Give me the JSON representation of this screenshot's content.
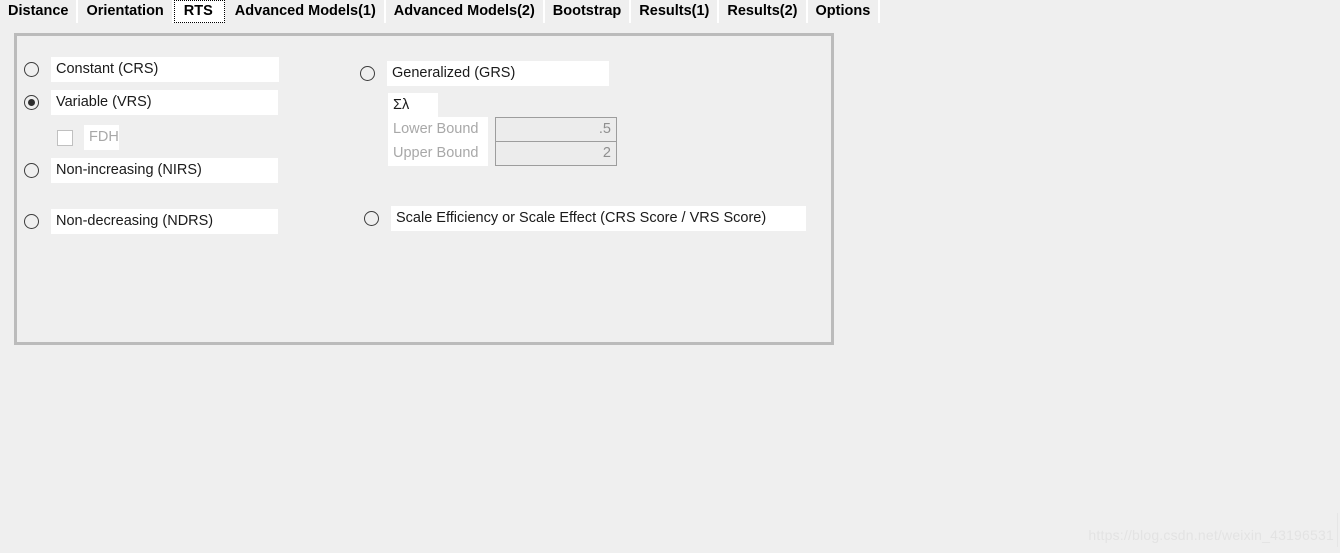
{
  "tabs": [
    {
      "label": "Distance",
      "active": false
    },
    {
      "label": "Orientation",
      "active": false
    },
    {
      "label": "RTS",
      "active": true
    },
    {
      "label": "Advanced Models(1)",
      "active": false
    },
    {
      "label": "Advanced Models(2)",
      "active": false
    },
    {
      "label": "Bootstrap",
      "active": false
    },
    {
      "label": "Results(1)",
      "active": false
    },
    {
      "label": "Results(2)",
      "active": false
    },
    {
      "label": "Options",
      "active": false
    }
  ],
  "panel": {
    "left_column": {
      "constant": {
        "label": "Constant (CRS)",
        "selected": false
      },
      "variable": {
        "label": "Variable (VRS)",
        "selected": true
      },
      "fdh": {
        "label": "FDH",
        "checked": false,
        "enabled": false
      },
      "non_increasing": {
        "label": "Non-increasing (NIRS)",
        "selected": false
      },
      "non_decreasing": {
        "label": "Non-decreasing (NDRS)",
        "selected": false
      }
    },
    "right_column": {
      "generalized": {
        "label": "Generalized (GRS)",
        "selected": false
      },
      "sum_lambda_label": "Σλ",
      "lower_bound": {
        "label": "Lower Bound",
        "value": ".5",
        "enabled": false
      },
      "upper_bound": {
        "label": "Upper Bound",
        "value": "2",
        "enabled": false
      },
      "scale_efficiency": {
        "label": "Scale Efficiency or Scale Effect (CRS Score / VRS Score)",
        "selected": false
      }
    }
  },
  "watermark": "https://blog.csdn.net/weixin_43196531",
  "colors": {
    "background": "#efefef",
    "panel_border": "#bbbbbb",
    "field_background": "#ffffff",
    "disabled_text": "#a8a8a8",
    "text": "#1a1a1a"
  }
}
